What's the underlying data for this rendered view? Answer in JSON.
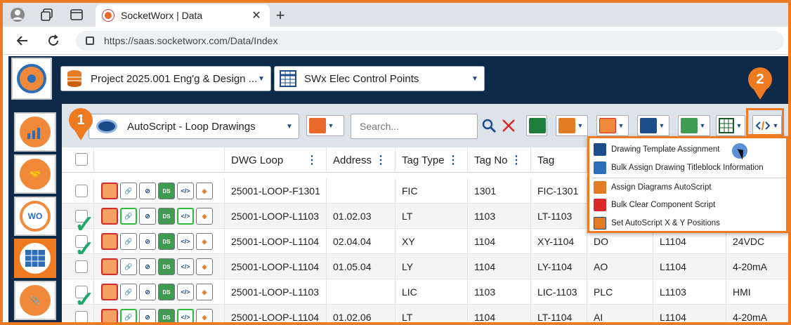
{
  "browser": {
    "tab_title": "SocketWorx | Data",
    "close_glyph": "✕",
    "newtab_glyph": "+",
    "url": "https://saas.socketworx.com/Data/Index"
  },
  "header": {
    "project_label": "Project 2025.001 Eng'g & Design ...",
    "dataset_label": "SWx Elec Control Points"
  },
  "toolbar": {
    "view_label": "AutoScript - Loop Drawings",
    "search_placeholder": "Search...",
    "buttons": [
      "views",
      "search",
      "clear",
      "excel",
      "report",
      "tag",
      "attach",
      "ds",
      "grid",
      "script"
    ]
  },
  "callouts": {
    "one": "1",
    "two": "2"
  },
  "table": {
    "columns": [
      "",
      "",
      "DWG Loop",
      "Address",
      "Tag Type",
      "Tag No",
      "Tag",
      "",
      "",
      ""
    ],
    "rows": [
      {
        "loop": "25001-LOOP-F1301",
        "address": "",
        "tag_type": "FIC",
        "tag_no": "1301",
        "tag": "FIC-1301",
        "io": "",
        "loop2": "",
        "signal": "",
        "checked": false
      },
      {
        "loop": "25001-LOOP-L1103",
        "address": "01.02.03",
        "tag_type": "LT",
        "tag_no": "1103",
        "tag": "LT-1103",
        "io": "",
        "loop2": "",
        "signal": "",
        "checked": true
      },
      {
        "loop": "25001-LOOP-L1104",
        "address": "02.04.04",
        "tag_type": "XY",
        "tag_no": "1104",
        "tag": "XY-1104",
        "io": "DO",
        "loop2": "L1104",
        "signal": "24VDC",
        "checked": true
      },
      {
        "loop": "25001-LOOP-L1104",
        "address": "01.05.04",
        "tag_type": "LY",
        "tag_no": "1104",
        "tag": "LY-1104",
        "io": "AO",
        "loop2": "L1104",
        "signal": "4-20mA",
        "checked": false
      },
      {
        "loop": "25001-LOOP-L1103",
        "address": "",
        "tag_type": "LIC",
        "tag_no": "1103",
        "tag": "LIC-1103",
        "io": "PLC",
        "loop2": "L1103",
        "signal": "HMI",
        "checked": true
      },
      {
        "loop": "25001-LOOP-L1104",
        "address": "01.02.06",
        "tag_type": "LT",
        "tag_no": "1104",
        "tag": "LT-1104",
        "io": "AI",
        "loop2": "L1104",
        "signal": "4-20mA",
        "checked": false
      }
    ]
  },
  "script_menu": {
    "items": [
      "Drawing Template Assignment",
      "Bulk Assign Drawing Titleblock Information",
      "Assign Diagrams AutoScript",
      "Bulk Clear Component Script",
      "Set AutoScript X & Y Positions"
    ]
  },
  "sidebar": {
    "wo_label": "WO"
  },
  "colors": {
    "accent": "#ee7b22",
    "navy": "#0e2a48",
    "check_green": "#1fa86a"
  }
}
